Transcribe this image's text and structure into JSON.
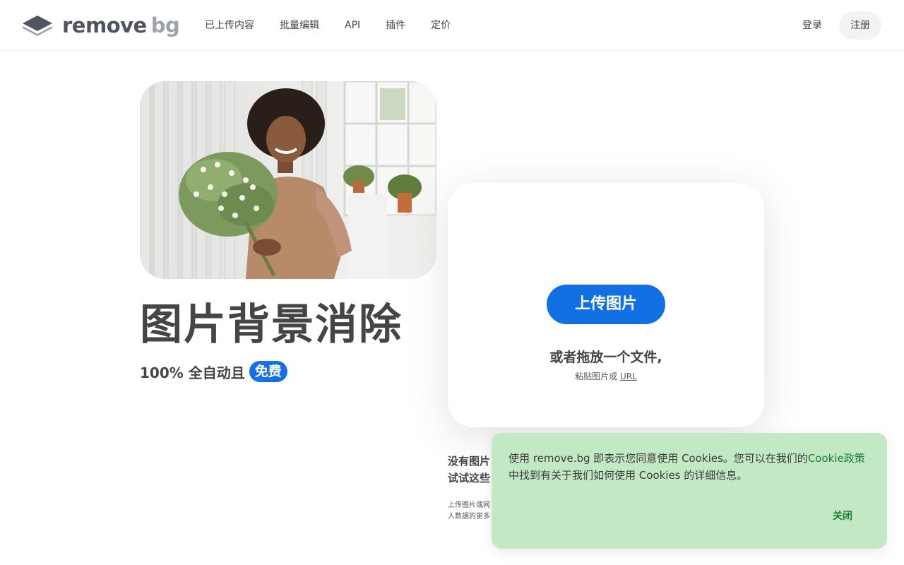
{
  "header": {
    "logo": {
      "text_main": "remove",
      "text_light": "bg"
    },
    "nav": [
      {
        "label": "已上传内容"
      },
      {
        "label": "批量编辑"
      },
      {
        "label": "API"
      },
      {
        "label": "插件"
      },
      {
        "label": "定价"
      }
    ],
    "login_label": "登录",
    "signup_label": "注册"
  },
  "hero": {
    "title": "图片背景消除",
    "subtitle": "100% 全自动且",
    "badge": "免费"
  },
  "upload": {
    "button_label": "上传图片",
    "drop_text": "或者拖放一个文件,",
    "paste_prefix": "粘贴图片或",
    "paste_url": "URL"
  },
  "below": {
    "line1": "没有图片",
    "line2": "试试这些",
    "terms_line1": "上传图片或网",
    "terms_line2": "人数据的更多"
  },
  "cookie": {
    "text_before": "使用 remove.bg 即表示您同意使用 Cookies。您可以在我们的",
    "link": "Cookie政策",
    "text_after": "中找到有关于我们如何使用 Cookies 的详细信息。",
    "close_label": "关闭"
  },
  "colors": {
    "accent": "#1170e3",
    "cookie_bg": "#c2e8c4",
    "cookie_link": "#1a7f2e"
  }
}
